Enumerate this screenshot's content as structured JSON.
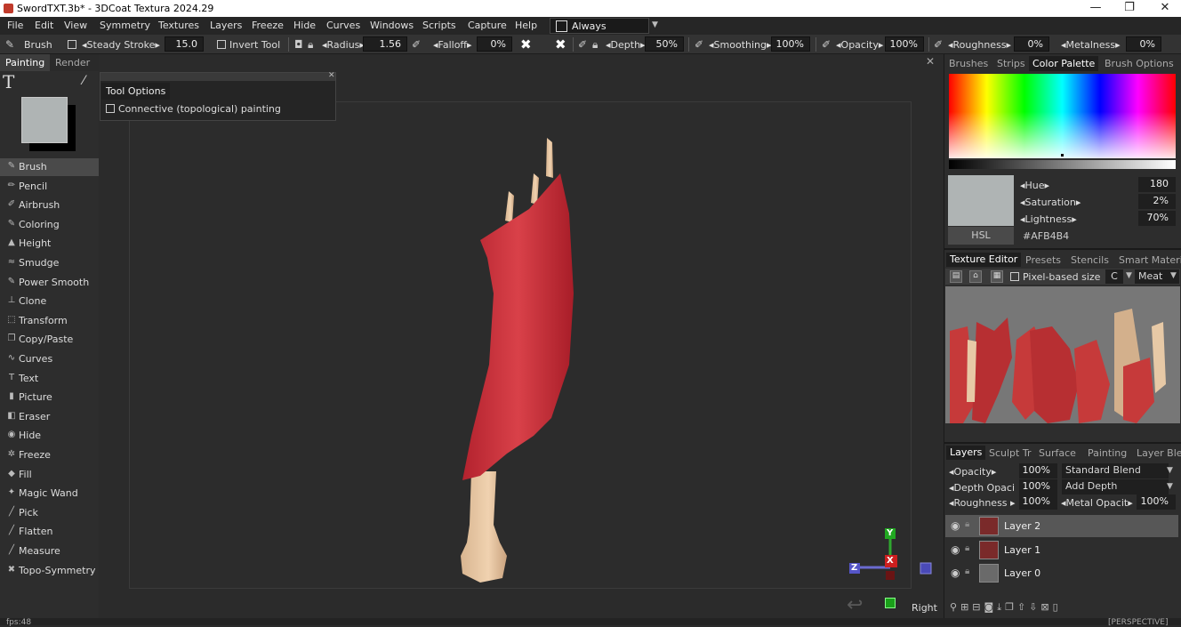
{
  "window": {
    "title": "SwordTXT.3b* - 3DCoat Textura 2024.29",
    "min": "—",
    "max": "❐",
    "close": "✕"
  },
  "menu": [
    "File",
    "Edit",
    "View",
    "Symmetry",
    "Textures",
    "Layers",
    "Freeze",
    "Hide",
    "Curves",
    "Windows",
    "Scripts",
    "Capture",
    "Help"
  ],
  "always_label": "Always",
  "toolbar": {
    "tool_name": "Brush",
    "steady_stroke_label": "Steady Stroke",
    "steady_stroke_value": "15.0",
    "invert_tool_label": "Invert Tool",
    "radius_label": "Radius",
    "radius_value": "1.56",
    "falloff_label": "Falloff",
    "falloff_value": "0%",
    "depth_label": "Depth",
    "depth_value": "50%",
    "smoothing_label": "Smoothing",
    "smoothing_value": "100%",
    "opacity_label": "Opacity",
    "opacity_value": "100%",
    "roughness_label": "Roughness",
    "roughness_value": "0%",
    "metalness_label": "Metalness",
    "metalness_value": "0%"
  },
  "left_tabs": [
    "Painting",
    "Render"
  ],
  "current_color": "#AFB4B4",
  "tools": [
    {
      "name": "brush",
      "label": "Brush",
      "icon": "✎"
    },
    {
      "name": "pencil",
      "label": "Pencil",
      "icon": "✏"
    },
    {
      "name": "airbrush",
      "label": "Airbrush",
      "icon": "✐"
    },
    {
      "name": "coloring",
      "label": "Coloring",
      "icon": "✎"
    },
    {
      "name": "height",
      "label": "Height",
      "icon": "▲"
    },
    {
      "name": "smudge",
      "label": "Smudge",
      "icon": "≈"
    },
    {
      "name": "power-smooth",
      "label": "Power Smooth",
      "icon": "✎"
    },
    {
      "name": "clone",
      "label": "Clone",
      "icon": "⊥"
    },
    {
      "name": "transform",
      "label": "Transform",
      "icon": "⬚"
    },
    {
      "name": "copy-paste",
      "label": "Copy/Paste",
      "icon": "❐"
    },
    {
      "name": "curves",
      "label": "Curves",
      "icon": "∿"
    },
    {
      "name": "text",
      "label": "Text",
      "icon": "T"
    },
    {
      "name": "picture",
      "label": "Picture",
      "icon": "▮"
    },
    {
      "name": "eraser",
      "label": "Eraser",
      "icon": "◧"
    },
    {
      "name": "hide",
      "label": "Hide",
      "icon": "◉"
    },
    {
      "name": "freeze",
      "label": "Freeze",
      "icon": "✲"
    },
    {
      "name": "fill",
      "label": "Fill",
      "icon": "◆"
    },
    {
      "name": "magic-wand",
      "label": "Magic Wand",
      "icon": "✦"
    },
    {
      "name": "pick",
      "label": "Pick",
      "icon": "╱"
    },
    {
      "name": "flatten",
      "label": "Flatten",
      "icon": "╱"
    },
    {
      "name": "measure",
      "label": "Measure",
      "icon": "╱"
    },
    {
      "name": "topo-symmetry",
      "label": "Topo-Symmetry",
      "icon": "✖"
    }
  ],
  "tool_options": {
    "tab": "Tool Options",
    "option": "Connective (topological) painting"
  },
  "viewport": {
    "view_name": "Right",
    "axis_y": "Y",
    "axis_x": "X",
    "axis_z": "Z"
  },
  "right_top_tabs": [
    "Brushes",
    "Strips",
    "Color Palette",
    "Brush Options"
  ],
  "color": {
    "hue_label": "Hue",
    "hue_value": "180",
    "sat_label": "Saturation",
    "sat_value": "2%",
    "light_label": "Lightness",
    "light_value": "70%",
    "mode": "HSL",
    "hex": "#AFB4B4"
  },
  "texture_tabs": [
    "Texture Editor",
    "Presets",
    "Stencils",
    "Smart Materi"
  ],
  "texture_bar": {
    "pixel_label": "Pixel-based size",
    "channel": "C",
    "mesh": "Meat"
  },
  "layer_tabs": [
    "Layers",
    "Sculpt Tr",
    "Surface",
    "Painting",
    "Layer Ble"
  ],
  "layer_props": {
    "opacity_label": "Opacity",
    "opacity_value": "100%",
    "blend": "Standard Blend",
    "depth_label": "Depth Opaci",
    "depth_value": "100%",
    "depth_mode": "Add Depth",
    "rough_label": "Roughness",
    "rough_value": "100%",
    "metal_label": "Metal Opacit",
    "metal_value": "100%"
  },
  "layers": [
    "Layer 2",
    "Layer 1",
    "Layer 0"
  ],
  "status": {
    "fps": "fps:48",
    "mode": "[PERSPECTIVE]"
  }
}
